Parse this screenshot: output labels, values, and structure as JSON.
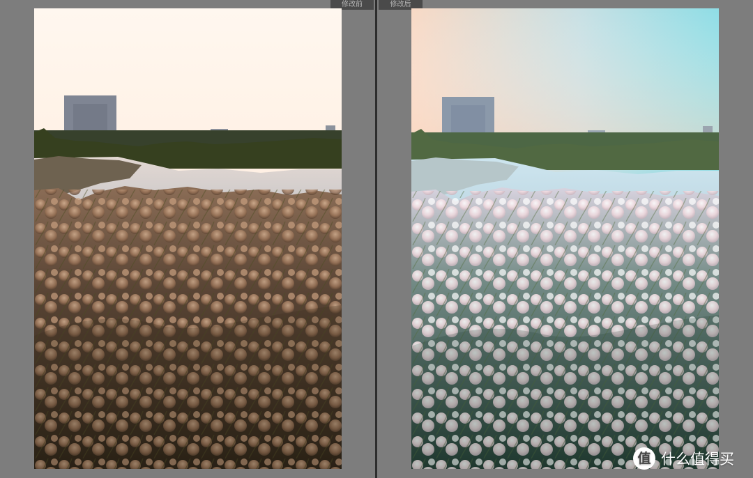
{
  "comparison": {
    "before_label": "修改前",
    "after_label": "修改后"
  },
  "watermark": {
    "icon_text": "值",
    "text": "什么值得买"
  },
  "icons": {
    "watermark_icon": "zdm-logo-icon"
  },
  "colors": {
    "background": "#7d7d7d",
    "divider": "#2d2d2d",
    "label_tab": "#4a4a4a",
    "before_sky": "#fff3e8",
    "after_sky": "#9ee1e8"
  }
}
